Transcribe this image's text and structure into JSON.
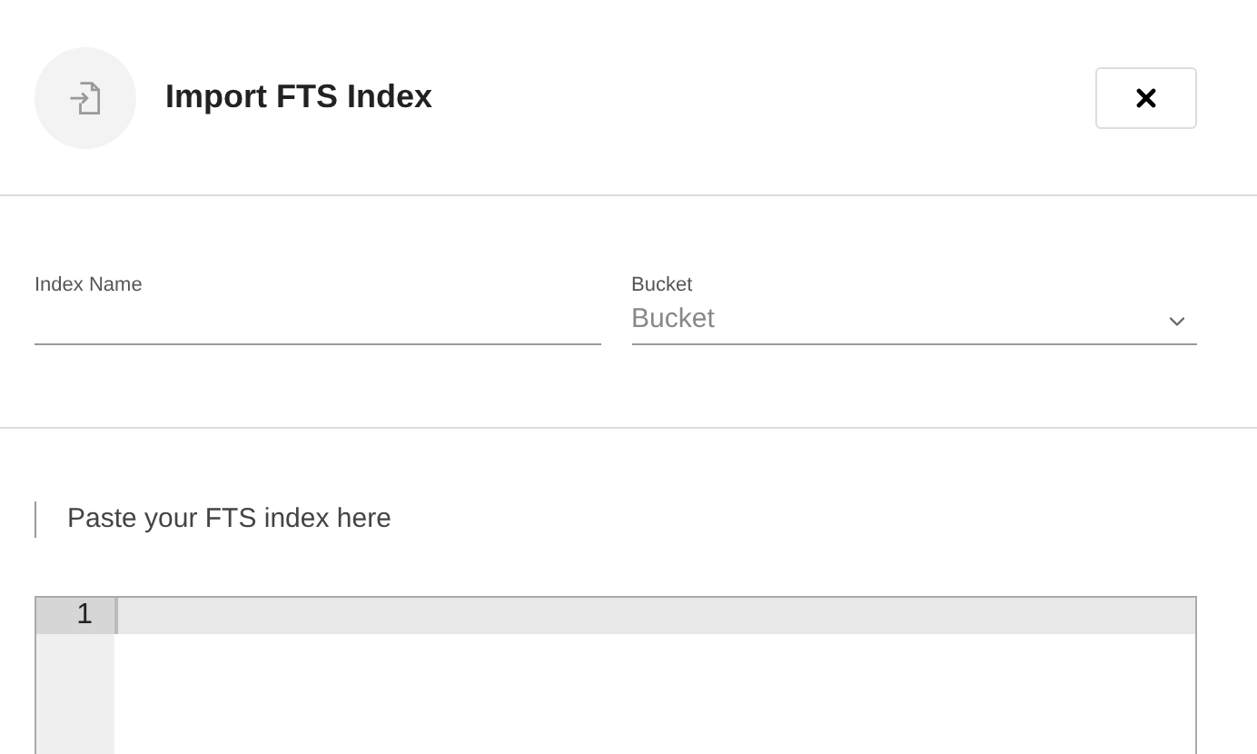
{
  "dialog": {
    "title": "Import FTS Index"
  },
  "fields": [
    {
      "kind": "text",
      "label": "Index Name"
    },
    {
      "kind": "select",
      "label": "Bucket",
      "placeholder": "Bucket"
    }
  ],
  "editor": {
    "hint": "Paste your FTS index here",
    "line_numbers": [
      "1"
    ]
  }
}
